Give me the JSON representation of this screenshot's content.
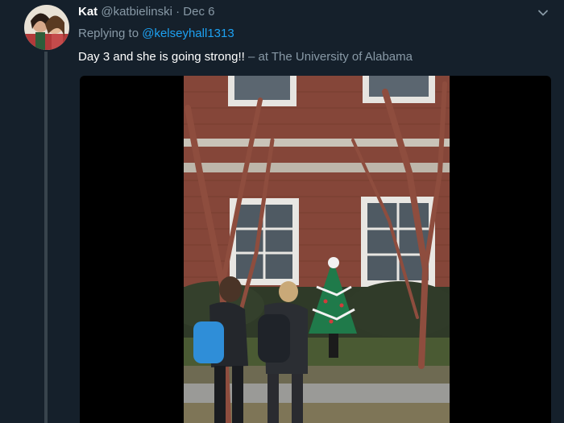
{
  "tweet": {
    "author_name": "Kat",
    "author_handle": "@katbielinski",
    "separator": "·",
    "date": "Dec 6",
    "replying_prefix": "Replying to",
    "replying_to": "@kelseyhall1313",
    "text": "Day 3 and she is going strong!!",
    "location": "– at The University of Alabama"
  },
  "icons": {
    "menu": "chevron-down-icon"
  },
  "colors": {
    "background": "#15202b",
    "text_primary": "#ffffff",
    "text_secondary": "#8899a6",
    "link": "#1da1f2",
    "thread_line": "#38444d"
  }
}
